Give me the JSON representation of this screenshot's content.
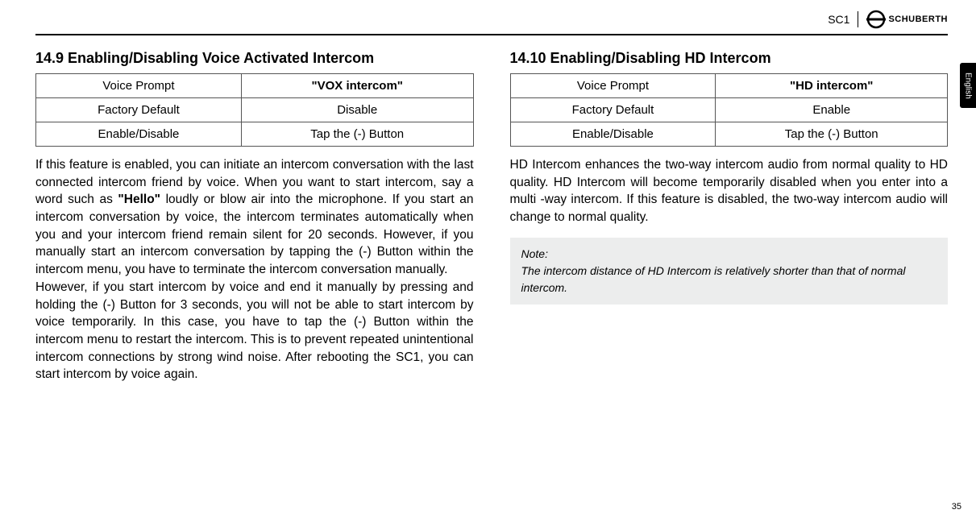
{
  "header": {
    "model": "SC1",
    "brand": "SCHUBERTH"
  },
  "lang_tab": "English",
  "page_number": "35",
  "left": {
    "title": "14.9 Enabling/Disabling Voice Activated Intercom",
    "table": {
      "r1c1": "Voice Prompt",
      "r1c2": "\"VOX intercom\"",
      "r2c1": "Factory Default",
      "r2c2": "Disable",
      "r3c1": "Enable/Disable",
      "r3c2": "Tap the (-) Button"
    },
    "p1a": "If this feature is enabled, you can initiate an intercom conversation with the last connected intercom friend by voice. When you want to start intercom, say a word such as ",
    "p1_hl": "\"Hello\"",
    "p1b": " loudly or blow air into the microphone. If you start an intercom conversation by voice, the intercom terminates automatically when you and your intercom friend remain silent for 20 seconds. However, if you manually start an intercom conversation by tapping the (-) Button within the intercom menu, you have to terminate the intercom conversation manually.",
    "p2": "However, if you start intercom by voice and end it manually by pressing and holding the (-) Button for 3 seconds, you will not be able to start intercom by voice temporarily. In this case, you have to tap the (-) Button within the intercom menu to restart the intercom. This is to prevent repeated unintentional intercom connections by strong wind noise. After rebooting the SC1, you can start intercom by voice again."
  },
  "right": {
    "title": "14.10 Enabling/Disabling HD Intercom",
    "table": {
      "r1c1": "Voice Prompt",
      "r1c2": "\"HD intercom\"",
      "r2c1": "Factory Default",
      "r2c2": "Enable",
      "r3c1": "Enable/Disable",
      "r3c2": "Tap the (-) Button"
    },
    "p1": "HD Intercom enhances the two-way intercom audio from normal quality to HD quality. HD Intercom will become temporarily disabled when you enter into a multi -way intercom. If this feature is disabled, the two-way intercom audio will change to normal quality.",
    "note_title": "Note:",
    "note_body": "The intercom distance of HD Intercom is relatively shorter than that of normal intercom."
  }
}
